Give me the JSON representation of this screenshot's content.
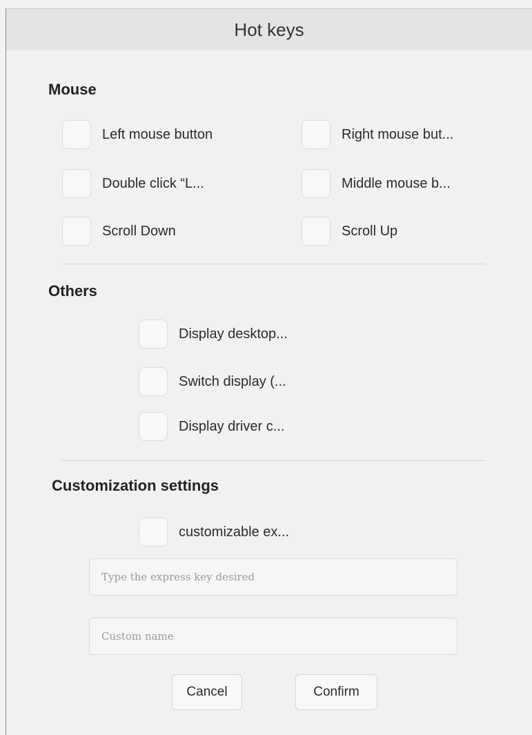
{
  "window": {
    "title": "Hot keys"
  },
  "mouse": {
    "heading": "Mouse",
    "options": [
      {
        "label": "Left mouse button",
        "checked": false
      },
      {
        "label": "Right mouse but...",
        "checked": false
      },
      {
        "label": "Double click  “L...",
        "checked": false
      },
      {
        "label": "Middle mouse b...",
        "checked": false
      },
      {
        "label": "Scroll Down",
        "checked": false
      },
      {
        "label": "Scroll Up",
        "checked": false
      }
    ]
  },
  "others": {
    "heading": "Others",
    "options": [
      {
        "label": "Display desktop...",
        "checked": false
      },
      {
        "label": "Switch display  (...",
        "checked": false
      },
      {
        "label": "Display driver c...",
        "checked": false
      }
    ]
  },
  "custom": {
    "heading": "Customization settings",
    "option": {
      "label": "customizable ex...",
      "checked": false
    },
    "key_input": {
      "value": "",
      "placeholder": "Type the express key desired"
    },
    "name_input": {
      "value": "",
      "placeholder": "Custom name"
    }
  },
  "buttons": {
    "cancel": "Cancel",
    "confirm": "Confirm"
  }
}
